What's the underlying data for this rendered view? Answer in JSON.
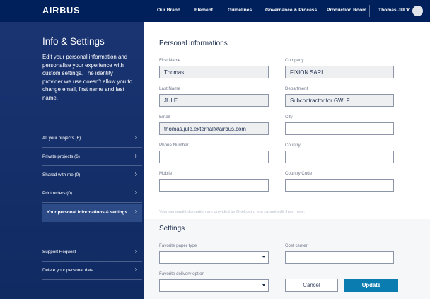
{
  "header": {
    "logo": "AIRBUS",
    "nav": [
      "Our Brand",
      "Element",
      "Guidelines",
      "Governance & Process",
      "Production Room"
    ],
    "user_name": "Thomas JULE"
  },
  "sidebar": {
    "title": "Info & Settings",
    "description": "Edit your personal information and personalise your experience with custom settings. The identity provider we use doesn't allow you to change email, first name and last name.",
    "items": [
      {
        "label": "All your projects (6)"
      },
      {
        "label": "Private projects (6)"
      },
      {
        "label": "Shared with me (0)"
      },
      {
        "label": "Print orders (0)"
      },
      {
        "label": "Your personal informations & settings",
        "active": true
      }
    ],
    "bottom_items": [
      {
        "label": "Support Request"
      },
      {
        "label": "Delete your personal data"
      }
    ]
  },
  "personal": {
    "title": "Personal informations",
    "first_name": {
      "label": "First Name",
      "value": "Thomas"
    },
    "company": {
      "label": "Company",
      "value": "FIXION SARL"
    },
    "last_name": {
      "label": "Last Name",
      "value": "JULE"
    },
    "department": {
      "label": "Department",
      "value": "Subcontractor for GWLF"
    },
    "email": {
      "label": "Email",
      "value": "thomas.jule.external@airbus.com"
    },
    "city": {
      "label": "City",
      "value": ""
    },
    "phone": {
      "label": "Phone Number",
      "value": ""
    },
    "country": {
      "label": "Country",
      "value": ""
    },
    "mobile": {
      "label": "Mobile",
      "value": ""
    },
    "country_code": {
      "label": "Country Code",
      "value": ""
    },
    "note": "Your personal information are provided by OneLogin, you cannot edit them here."
  },
  "settings": {
    "title": "Settings",
    "paper_type": {
      "label": "Favorite paper type",
      "value": ""
    },
    "cost_center": {
      "label": "Cost center",
      "value": ""
    },
    "delivery_option": {
      "label": "Favorite delivery option",
      "value": ""
    },
    "cancel_label": "Cancel",
    "update_label": "Update"
  },
  "colors": {
    "navy": "#00205b",
    "sidebar": "#15306a",
    "accent": "#0b7cb0"
  }
}
